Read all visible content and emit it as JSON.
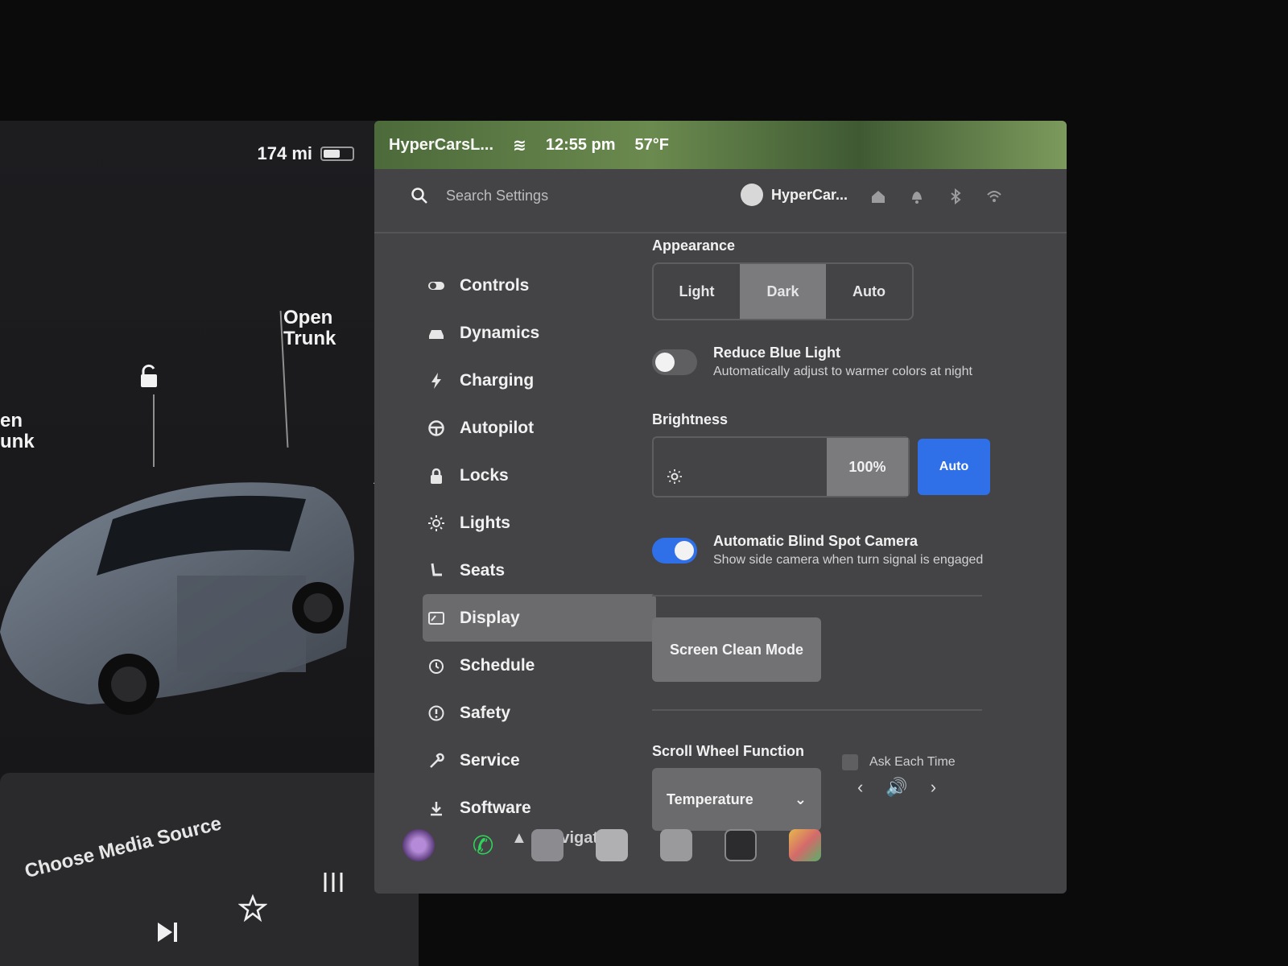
{
  "vehicle": {
    "range": "174 mi",
    "battery_level_fraction": 0.6,
    "callouts": {
      "open_trunk_right": "Open\nTrunk",
      "open_trunk_left": "en\nunk"
    }
  },
  "media": {
    "source_label": "Choose Media Source"
  },
  "status_bar": {
    "profile_name": "HyperCarsL...",
    "time": "12:55 pm",
    "temperature": "57°F"
  },
  "header": {
    "search_placeholder": "Search Settings",
    "profile_name": "HyperCar..."
  },
  "sidebar": {
    "items": [
      {
        "label": "Controls",
        "icon": "toggle-icon",
        "active": false
      },
      {
        "label": "Dynamics",
        "icon": "car-icon",
        "active": false
      },
      {
        "label": "Charging",
        "icon": "bolt-icon",
        "active": false
      },
      {
        "label": "Autopilot",
        "icon": "steering-wheel-icon",
        "active": false
      },
      {
        "label": "Locks",
        "icon": "lock-icon",
        "active": false
      },
      {
        "label": "Lights",
        "icon": "sun-icon",
        "active": false
      },
      {
        "label": "Seats",
        "icon": "seat-icon",
        "active": false
      },
      {
        "label": "Display",
        "icon": "display-icon",
        "active": true
      },
      {
        "label": "Schedule",
        "icon": "clock-icon",
        "active": false
      },
      {
        "label": "Safety",
        "icon": "alert-icon",
        "active": false
      },
      {
        "label": "Service",
        "icon": "wrench-icon",
        "active": false
      },
      {
        "label": "Software",
        "icon": "download-icon",
        "active": false
      }
    ],
    "partial_item": "Navigation"
  },
  "display_settings": {
    "appearance_label": "Appearance",
    "appearance_options": [
      "Light",
      "Dark",
      "Auto"
    ],
    "appearance_selected": "Dark",
    "reduce_blue_light": {
      "title": "Reduce Blue Light",
      "subtitle": "Automatically adjust to warmer colors at night",
      "enabled": false
    },
    "brightness_label": "Brightness",
    "brightness_value": "100%",
    "brightness_auto_label": "Auto",
    "blind_spot": {
      "title": "Automatic Blind Spot Camera",
      "subtitle": "Show side camera when turn signal is engaged",
      "enabled": true
    },
    "screen_clean_label": "Screen Clean Mode",
    "scroll_wheel_label": "Scroll Wheel Function",
    "scroll_wheel_value": "Temperature",
    "ask_each_time_label": "Ask Each Time",
    "ask_each_time_checked": false
  },
  "colors": {
    "accent_blue": "#2f6fe8",
    "panel_bg": "#444446",
    "selected_bg": "#7b7b7e"
  }
}
